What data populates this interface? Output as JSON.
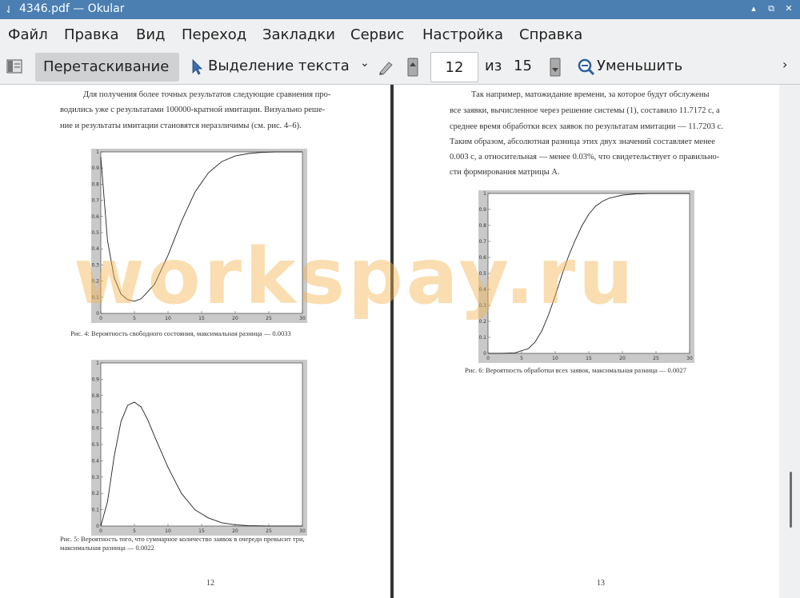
{
  "window": {
    "title": "4346.pdf — Okular"
  },
  "menu": [
    "Файл",
    "Правка",
    "Вид",
    "Переход",
    "Закладки",
    "Сервис",
    "Настройка",
    "Справка"
  ],
  "toolbar": {
    "drag_label": "Перетаскивание",
    "select_label": "Выделение текста",
    "page_value": "12",
    "of_label": "из",
    "total_pages": "15",
    "zoom_out_label": "Уменьшить"
  },
  "watermark": "workspay.ru",
  "left_page": {
    "text_line1": "Для получения более точных результатов следующие сравнения про-",
    "text_line2": "водились уже с результатами 100000-кратной имитации. Визуально реше-",
    "text_line3": "ние и результаты имитации становятся неразличимы (см. рис. 4–6).",
    "caption4": "Рис. 4: Вероятность свободного состояния, максимальная разница — 0.0033",
    "caption5_line1": "Рис. 5: Вероятность того, что суммарное количество заявок в очереди превысит три,",
    "caption5_line2": "максимальная разница — 0.0022",
    "page_number": "12"
  },
  "right_page": {
    "text_line1": "Так например, матожидание времени, за которое будут обслужены",
    "text_line2": "все заявки, вычисленное через решение системы (1), составило 11.7172 с, а",
    "text_line3": "среднее время обработки всех заявок по результатам имитации — 11.7203 с.",
    "text_line4": "Таким образом, абсолютная разница этих двух значений составляет менее",
    "text_line5": "0.003 с, а относительная — менее 0.03%, что свидетельствует о правильно-",
    "text_line6": "сти формирования матрицы A.",
    "caption6": "Рис. 6: Вероятность обработки всех заявок, максимальная разница — 0.0027",
    "page_number": "13"
  },
  "chart_data": [
    {
      "type": "line",
      "xlim": [
        0,
        30
      ],
      "ylim": [
        0,
        1
      ],
      "xticks": [
        0,
        5,
        10,
        15,
        20,
        25,
        30
      ],
      "yticks": [
        0,
        0.1,
        0.2,
        0.3,
        0.4,
        0.5,
        0.6,
        0.7,
        0.8,
        0.9,
        1
      ],
      "series": [
        {
          "x": [
            0,
            1,
            2,
            3,
            4,
            5,
            6,
            8,
            10,
            12,
            14,
            16,
            18,
            20,
            22,
            24,
            26,
            30
          ],
          "y": [
            0.97,
            0.45,
            0.22,
            0.12,
            0.085,
            0.075,
            0.09,
            0.18,
            0.36,
            0.57,
            0.75,
            0.87,
            0.94,
            0.975,
            0.99,
            0.997,
            1.0,
            1.0
          ]
        }
      ]
    },
    {
      "type": "line",
      "xlim": [
        0,
        30
      ],
      "ylim": [
        0,
        1
      ],
      "xticks": [
        0,
        5,
        10,
        15,
        20,
        25,
        30
      ],
      "yticks": [
        0,
        0.1,
        0.2,
        0.3,
        0.4,
        0.5,
        0.6,
        0.7,
        0.8,
        0.9,
        1
      ],
      "series": [
        {
          "x": [
            0,
            1,
            2,
            3,
            4,
            5,
            6,
            7,
            8,
            10,
            12,
            14,
            16,
            18,
            20,
            22,
            25,
            30
          ],
          "y": [
            0.0,
            0.15,
            0.43,
            0.64,
            0.74,
            0.76,
            0.73,
            0.65,
            0.55,
            0.36,
            0.2,
            0.1,
            0.05,
            0.02,
            0.008,
            0.003,
            0.0,
            0.0
          ]
        }
      ]
    },
    {
      "type": "line",
      "xlim": [
        0,
        30
      ],
      "ylim": [
        0,
        1
      ],
      "xticks": [
        0,
        5,
        10,
        15,
        20,
        25,
        30
      ],
      "yticks": [
        0,
        0.1,
        0.2,
        0.3,
        0.4,
        0.5,
        0.6,
        0.7,
        0.8,
        0.9,
        1
      ],
      "series": [
        {
          "x": [
            0,
            2,
            4,
            6,
            7,
            8,
            9,
            10,
            11,
            12,
            13,
            14,
            15,
            16,
            17,
            18,
            20,
            22,
            24,
            26,
            30
          ],
          "y": [
            0.0,
            0.0,
            0.003,
            0.03,
            0.07,
            0.14,
            0.24,
            0.36,
            0.49,
            0.61,
            0.71,
            0.8,
            0.87,
            0.92,
            0.95,
            0.97,
            0.99,
            0.997,
            1.0,
            1.0,
            1.0
          ]
        }
      ]
    }
  ]
}
